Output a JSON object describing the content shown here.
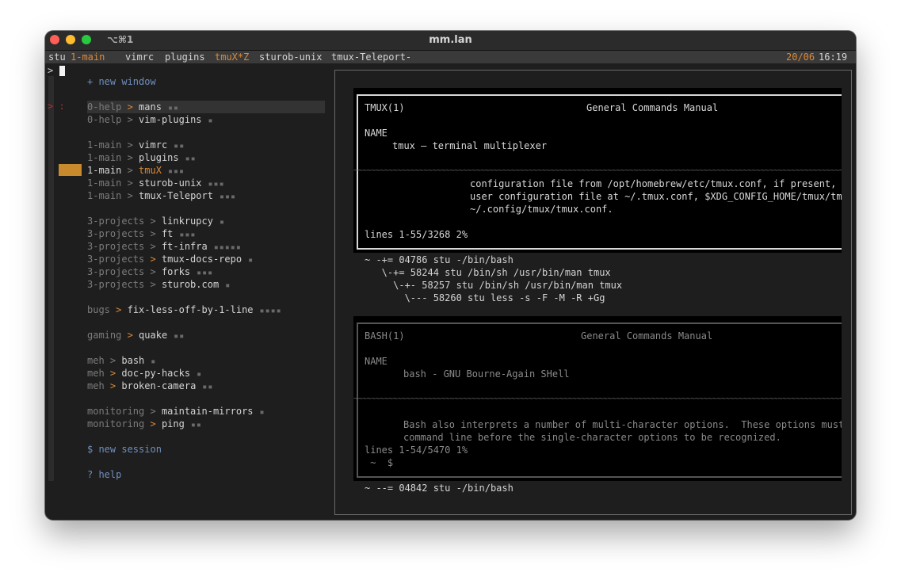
{
  "window": {
    "shortcut": "⌥⌘1",
    "title": "mm.lan"
  },
  "statusbar": {
    "session": "stu",
    "current_window": "1-main",
    "windows": [
      "vimrc",
      "plugins",
      "tmuX*Z",
      "sturob-unix",
      "tmux-Teleport-"
    ],
    "date": "20/06",
    "time": "16:19"
  },
  "sidebar": {
    "prompt": ">",
    "new_window": "+ new window",
    "groups": [
      [
        {
          "session": "0-help",
          "name": "mans",
          "dots": "▪▪",
          "selected": true
        },
        {
          "session": "0-help",
          "name": "vim-plugins",
          "dots": "▪"
        }
      ],
      [
        {
          "session": "1-main",
          "name": "vimrc",
          "dots": "▪▪"
        },
        {
          "session": "1-main",
          "name": "plugins",
          "dots": "▪▪"
        },
        {
          "session": "1-main",
          "name": "tmuX",
          "dots": "▪▪▪",
          "current": true
        },
        {
          "session": "1-main",
          "name": "sturob-unix",
          "dots": "▪▪▪"
        },
        {
          "session": "1-main",
          "name": "tmux-Teleport",
          "dots": "▪▪▪"
        }
      ],
      [
        {
          "session": "3-projects",
          "name": "linkrupcy",
          "dots": "▪"
        },
        {
          "session": "3-projects",
          "name": "ft",
          "dots": "▪▪▪"
        },
        {
          "session": "3-projects",
          "name": "ft-infra",
          "dots": "▪▪▪▪▪"
        },
        {
          "session": "3-projects",
          "name": "tmux-docs-repo",
          "dots": "▪"
        },
        {
          "session": "3-projects",
          "name": "forks",
          "dots": "▪▪▪"
        },
        {
          "session": "3-projects",
          "name": "sturob.com",
          "dots": "▪"
        }
      ],
      [
        {
          "session": "bugs",
          "name": "fix-less-off-by-1-line",
          "dots": "▪▪▪▪"
        }
      ],
      [
        {
          "session": "gaming",
          "name": "quake",
          "dots": "▪▪"
        }
      ],
      [
        {
          "session": "meh",
          "name": "bash",
          "dots": "▪"
        },
        {
          "session": "meh",
          "name": "doc-py-hacks",
          "dots": "▪"
        },
        {
          "session": "meh",
          "name": "broken-camera",
          "dots": "▪▪"
        }
      ],
      [
        {
          "session": "monitoring",
          "name": "maintain-mirrors",
          "dots": "▪"
        },
        {
          "session": "monitoring",
          "name": "ping",
          "dots": "▪▪"
        }
      ]
    ],
    "new_session": "$ new session",
    "help": "? help"
  },
  "preview": {
    "pane1": {
      "header_left": "TMUX(1)",
      "header_center": "General Commands Manual",
      "name_heading": "NAME",
      "name_line": "tmux – terminal multiplexer",
      "body": [
        "configuration file from /opt/homebrew/etc/tmux.conf, if present, th",
        "user configuration file at ~/.tmux.conf, $XDG_CONFIG_HOME/tmux/tmux",
        "~/.config/tmux/tmux.conf."
      ],
      "status": "lines 1-55/3268 2%"
    },
    "proc_tree1": [
      "~ -+= 04786 stu -/bin/bash",
      "   \\-+= 58244 stu /bin/sh /usr/bin/man tmux",
      "     \\-+- 58257 stu /bin/sh /usr/bin/man tmux",
      "       \\--- 58260 stu less -s -F -M -R +Gg"
    ],
    "pane2": {
      "header_left": "BASH(1)",
      "header_center": "General Commands Manual",
      "name_heading": "NAME",
      "name_line": "bash - GNU Bourne-Again SHell",
      "body": [
        "Bash also interprets a number of multi-character options.  These options must a",
        "command line before the single-character options to be recognized."
      ],
      "status": "lines 1-54/5470 1%",
      "prompt": " ~  $"
    },
    "proc_tree2": [
      "~ --= 04842 stu -/bin/bash"
    ],
    "tilde_rule": "~~~~~~~~~~~~~~~~~~~~~~~~~~~~~~~~~~~~~~~~~~~~~~~~~~~~~~~~~~~~~~~~~~~~~~~~~~~~~~~~~~~~~~~~~~~~~~~~~~~~~~~~~~~~~~~~~~~~~~~~~~~~~~~"
  }
}
